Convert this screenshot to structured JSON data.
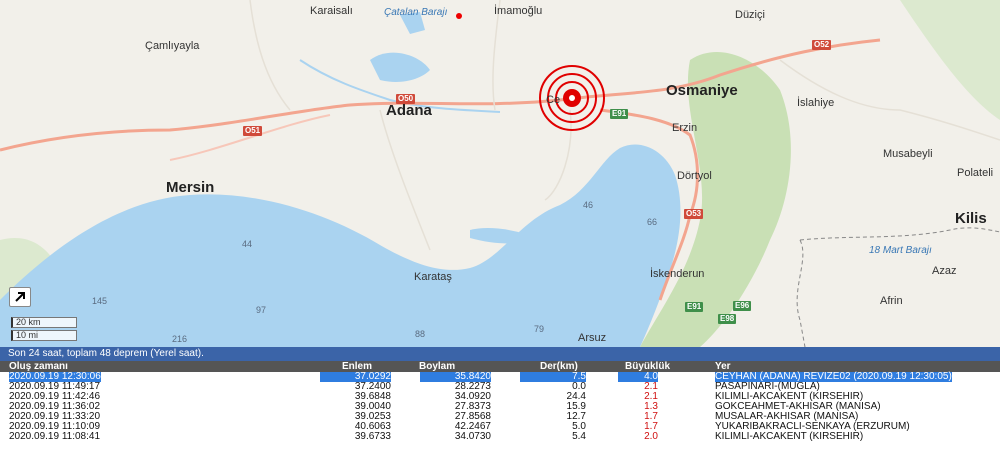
{
  "map": {
    "cities_major": [
      {
        "name": "Adana",
        "id": "adana"
      },
      {
        "name": "Osmaniye",
        "id": "osmaniye"
      },
      {
        "name": "Mersin",
        "id": "mersin"
      },
      {
        "name": "Kilis",
        "id": "kilis"
      }
    ],
    "cities_minor": [
      {
        "name": "Karaisalı",
        "id": "karaisali"
      },
      {
        "name": "İmamoğlu",
        "id": "imamoglu"
      },
      {
        "name": "Düziçi",
        "id": "duzici"
      },
      {
        "name": "Çamlıyayla",
        "id": "camliyayla"
      },
      {
        "name": "Erzin",
        "id": "erzin"
      },
      {
        "name": "İslahiye",
        "id": "islahiye"
      },
      {
        "name": "Musabeyli",
        "id": "musabeyli"
      },
      {
        "name": "Polateli",
        "id": "polateli"
      },
      {
        "name": "Dörtyol",
        "id": "dortyol"
      },
      {
        "name": "Karataş",
        "id": "karatas"
      },
      {
        "name": "İskenderun",
        "id": "iskenderun"
      },
      {
        "name": "Azaz",
        "id": "azaz"
      },
      {
        "name": "Afrin",
        "id": "afrin"
      },
      {
        "name": "Arsuz",
        "id": "arsuz"
      },
      {
        "name": "Ce",
        "id": "ceyhan"
      }
    ],
    "water_labels": {
      "dam1": "Çatalan Barajı",
      "dam2": "18 Mart Barajı"
    },
    "depths": [
      "46",
      "66",
      "44",
      "97",
      "145",
      "216",
      "88",
      "79"
    ],
    "roads": [
      "O52",
      "O50",
      "O51",
      "E91",
      "O53",
      "E91",
      "E96",
      "E98"
    ],
    "scale": {
      "km": "20 km",
      "mi": "10 mi"
    }
  },
  "status": "Son 24 saat, toplam 48 deprem (Yerel saat).",
  "table": {
    "headers": {
      "time": "Oluş zamanı",
      "lat": "Enlem",
      "lon": "Boylam",
      "depth": "Der(km)",
      "mag": "Büyüklük",
      "place": "Yer"
    },
    "rows": [
      {
        "time": "2020.09.19 12:30:06",
        "lat": "37.0292",
        "lon": "35.8420",
        "depth": "7.5",
        "mag": "4.0",
        "place": "CEYHAN (ADANA) REVIZE02 (2020.09.19 12:30:05)"
      },
      {
        "time": "2020.09.19 11:49:17",
        "lat": "37.2400",
        "lon": "28.2273",
        "depth": "0.0",
        "mag": "2.1",
        "place": "PASAPINARI-(MUGLA)"
      },
      {
        "time": "2020.09.19 11:42:46",
        "lat": "39.6848",
        "lon": "34.0920",
        "depth": "24.4",
        "mag": "2.1",
        "place": "KILIMLI-AKCAKENT (KIRSEHIR)"
      },
      {
        "time": "2020.09.19 11:36:02",
        "lat": "39.0040",
        "lon": "27.8373",
        "depth": "15.9",
        "mag": "1.3",
        "place": "GOKCEAHMET-AKHISAR (MANISA)"
      },
      {
        "time": "2020.09.19 11:33:20",
        "lat": "39.0253",
        "lon": "27.8568",
        "depth": "12.7",
        "mag": "1.7",
        "place": "MUSALAR-AKHISAR (MANISA)"
      },
      {
        "time": "2020.09.19 11:10:09",
        "lat": "40.6063",
        "lon": "42.2467",
        "depth": "5.0",
        "mag": "1.7",
        "place": "YUKARIBAKRACLI-SENKAYA (ERZURUM)"
      },
      {
        "time": "2020.09.19 11:08:41",
        "lat": "39.6733",
        "lon": "34.0730",
        "depth": "5.4",
        "mag": "2.0",
        "place": "KILIMLI-AKCAKENT (KIRSEHIR)"
      }
    ]
  },
  "colors": {
    "sea": "#aad3f0",
    "land": "#f2f0ea",
    "forest": "#c5dfb3",
    "status_bar": "#3b64a8",
    "header": "#555555",
    "selection": "#2f7de0",
    "quake": "#e00000"
  }
}
